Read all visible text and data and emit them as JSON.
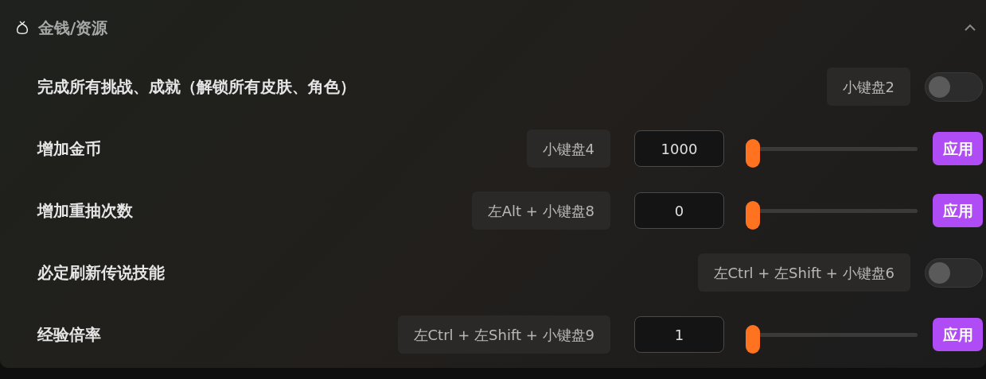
{
  "section": {
    "title": "金钱/资源",
    "expanded": true
  },
  "rows": [
    {
      "kind": "toggle",
      "label": "完成所有挑战、成就（解锁所有皮肤、角色）",
      "hotkey": "小键盘2",
      "on": false
    },
    {
      "kind": "slider",
      "label": "增加金币",
      "hotkey": "小键盘4",
      "value": "1000",
      "level": 0,
      "button": "应用"
    },
    {
      "kind": "slider",
      "label": "增加重抽次数",
      "hotkey": "左Alt + 小键盘8",
      "value": "0",
      "level": 0,
      "button": "应用"
    },
    {
      "kind": "toggle",
      "label": "必定刷新传说技能",
      "hotkey": "左Ctrl + 左Shift + 小键盘6",
      "on": false
    },
    {
      "kind": "slider",
      "label": "经验倍率",
      "hotkey": "左Ctrl + 左Shift + 小键盘9",
      "value": "1",
      "level": 0,
      "button": "应用"
    }
  ]
}
